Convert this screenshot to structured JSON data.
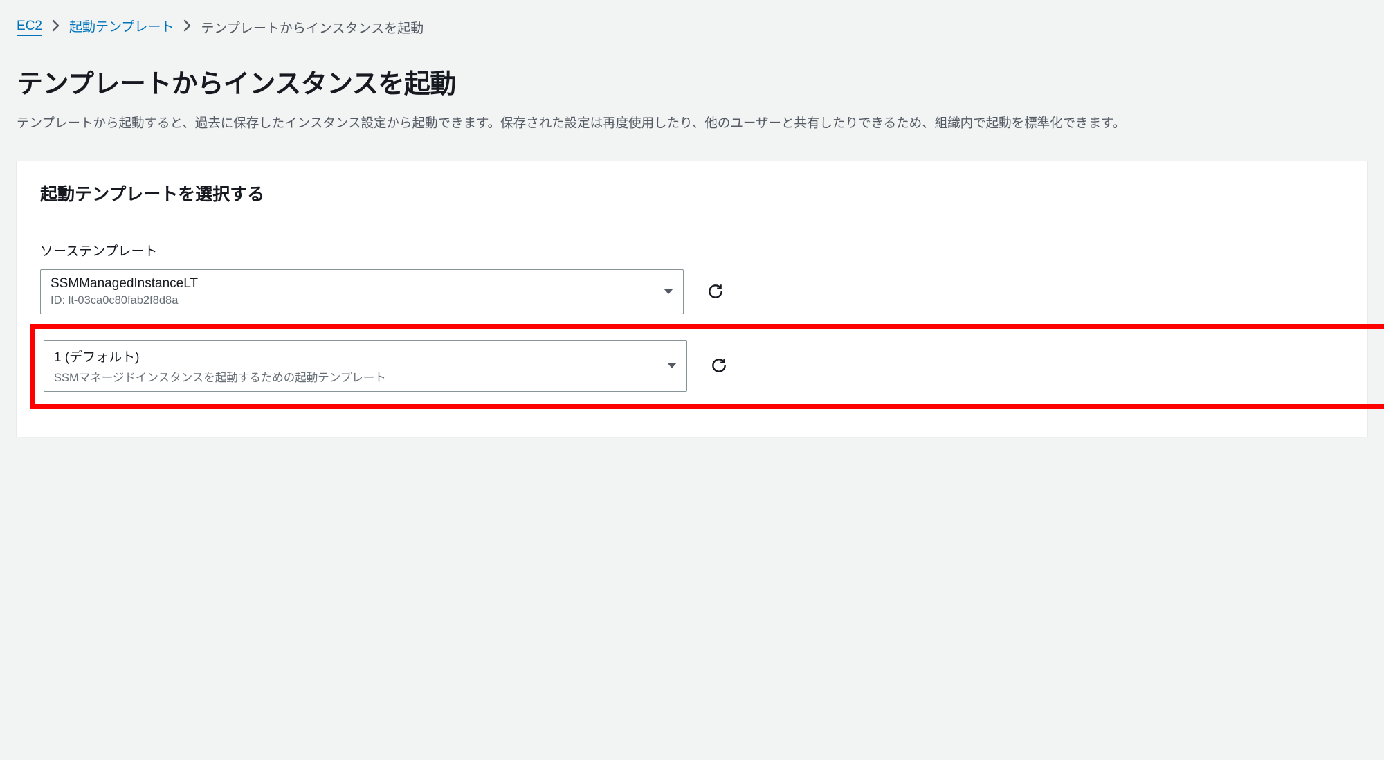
{
  "breadcrumb": {
    "root": "EC2",
    "mid": "起動テンプレート",
    "current": "テンプレートからインスタンスを起動"
  },
  "page": {
    "title": "テンプレートからインスタンスを起動",
    "description": "テンプレートから起動すると、過去に保存したインスタンス設定から起動できます。保存された設定は再度使用したり、他のユーザーと共有したりできるため、組織内で起動を標準化できます。"
  },
  "panel": {
    "title": "起動テンプレートを選択する",
    "source_label": "ソーステンプレート",
    "template_select": {
      "main": "SSMManagedInstanceLT",
      "sub": "ID: lt-03ca0c80fab2f8d8a"
    },
    "version_select": {
      "main": "1 (デフォルト)",
      "sub": "SSMマネージドインスタンスを起動するための起動テンプレート"
    }
  }
}
